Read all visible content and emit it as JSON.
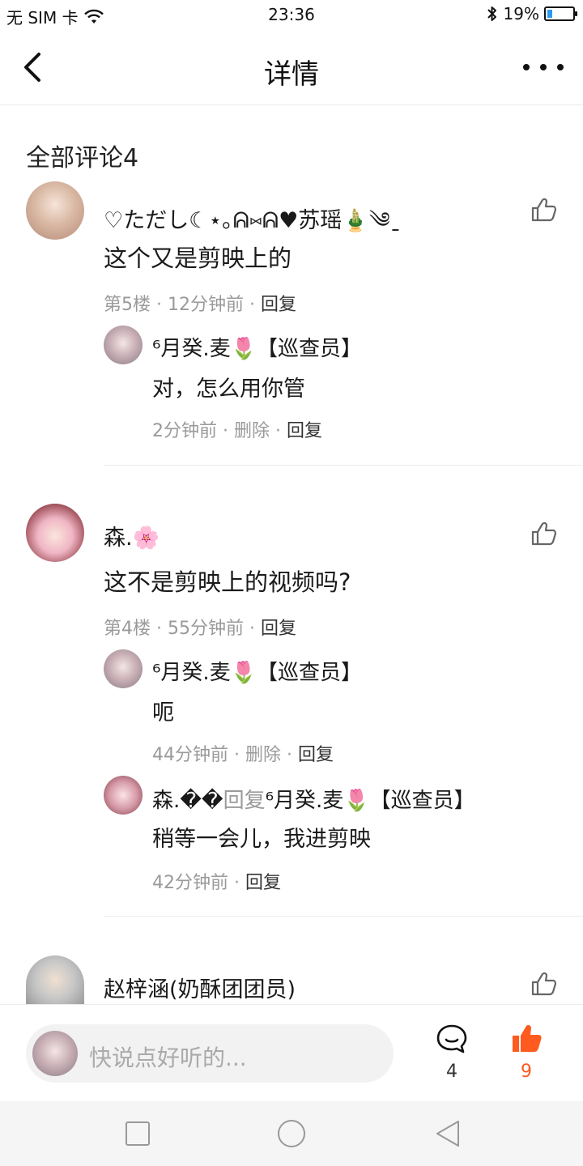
{
  "status_bar": {
    "carrier": "无 SIM 卡",
    "time": "23:36",
    "battery": "19%",
    "battery_level": 0.19
  },
  "header": {
    "title": "详情"
  },
  "section": {
    "title": "全部评论4"
  },
  "comments": [
    {
      "author": "♡ただし☾⋆｡ᕱ⑅ᕱ♥苏瑶🎍༄ˍ",
      "text": "这个又是剪映上的",
      "floor": "第5楼",
      "time": "12分钟前",
      "reply": "回复",
      "replies": [
        {
          "author": "⁶月癸.麦🌷【巡查员】",
          "text": "对，怎么用你管",
          "time": "2分钟前",
          "delete": "删除",
          "reply": "回复"
        }
      ]
    },
    {
      "author": "森.🌸",
      "text": "这不是剪映上的视频吗?",
      "floor": "第4楼",
      "time": "55分钟前",
      "reply": "回复",
      "replies": [
        {
          "author": "⁶月癸.麦🌷【巡查员】",
          "text": "呃",
          "time": "44分钟前",
          "delete": "删除",
          "reply": "回复"
        },
        {
          "author": "森.��",
          "reply_word": "回复",
          "target": "⁶月癸.麦🌷【巡查员】",
          "text": "稍等一会儿，我进剪映",
          "time": "42分钟前",
          "reply": "回复"
        }
      ]
    },
    {
      "author": "赵梓涵(奶酥团团员)"
    }
  ],
  "bottom_bar": {
    "placeholder": "快说点好听的...",
    "comment_count": "4",
    "like_count": "9",
    "accent_color": "#ff5a1f"
  }
}
